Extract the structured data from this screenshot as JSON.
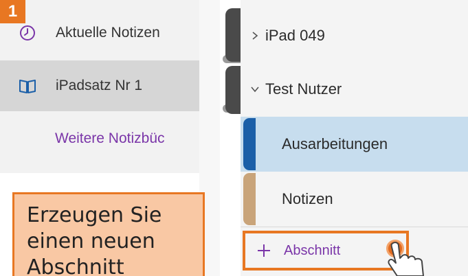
{
  "step_badge": "1",
  "notebooks_pane": {
    "recent_label": "Aktuelle Notizen",
    "current_notebook": "iPadsatz Nr 1",
    "more_notebooks": "Weitere Notizbüc"
  },
  "sections_pane": {
    "notebooks": [
      {
        "label": "iPad 049",
        "expanded": false
      },
      {
        "label": "Test Nutzer",
        "expanded": true
      }
    ],
    "sections": [
      {
        "label": "Ausarbeitungen",
        "color": "#1b5fa8",
        "selected": true
      },
      {
        "label": "Notizen",
        "color": "#c9a47a",
        "selected": false
      }
    ],
    "add_section_label": "Abschnitt"
  },
  "callout": {
    "lines": [
      "Erzeugen Sie",
      "einen neuen",
      "Abschnitt"
    ]
  },
  "colors": {
    "accent_orange": "#e87722",
    "link_purple": "#7a35a8",
    "selected_blue": "#c7ddee"
  }
}
